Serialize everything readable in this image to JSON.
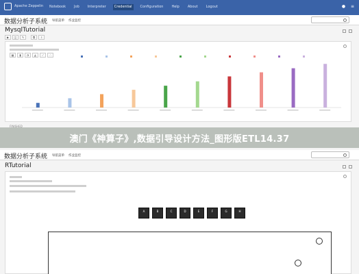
{
  "app": {
    "name": "Apache Zeppelin",
    "nav": [
      "Notebook",
      "Job",
      "Interpreter",
      "Credential",
      "Configuration",
      "Help",
      "About",
      "Logout"
    ],
    "active_nav_index": 3,
    "brand_color": "#3a63a8"
  },
  "top_section": {
    "header_title": "数据分析子系统",
    "header_tabs": [
      "导航菜单",
      "作业监控"
    ],
    "notebook_title": "MysqlTutorial",
    "paragraph_status": "FINISHED"
  },
  "bottom_section": {
    "header_title": "数据分析子系统",
    "header_tabs": [
      "导航菜单",
      "作业监控"
    ],
    "notebook_title": "RTutorial"
  },
  "banner": {
    "text": "澳门《神算子》,数据引导设计方法_图形版ETL14.37"
  },
  "chart_data": {
    "type": "bar",
    "categories": [
      "1",
      "2",
      "3",
      "4",
      "5",
      "6",
      "7",
      "8",
      "9",
      "10"
    ],
    "series": [
      {
        "values": [
          1.6,
          3.2,
          4.6,
          6.1,
          7.5,
          9.0,
          10.7,
          12.1,
          13.5,
          15.0
        ]
      }
    ],
    "colors": [
      "#4a73b8",
      "#a9c4e8",
      "#f3a35c",
      "#f7c89a",
      "#4aa54a",
      "#a4d88f",
      "#c9373b",
      "#f08f8a",
      "#9a6bc2",
      "#c9b1de"
    ],
    "ylim": [
      0,
      16
    ]
  },
  "r_output": {
    "cells": [
      "A",
      "B",
      "C",
      "D",
      "E",
      "F",
      "G",
      "H"
    ]
  },
  "icons": {
    "logo": "zeppelin-logo-icon",
    "search": "search-icon",
    "settings": "gear-icon"
  }
}
